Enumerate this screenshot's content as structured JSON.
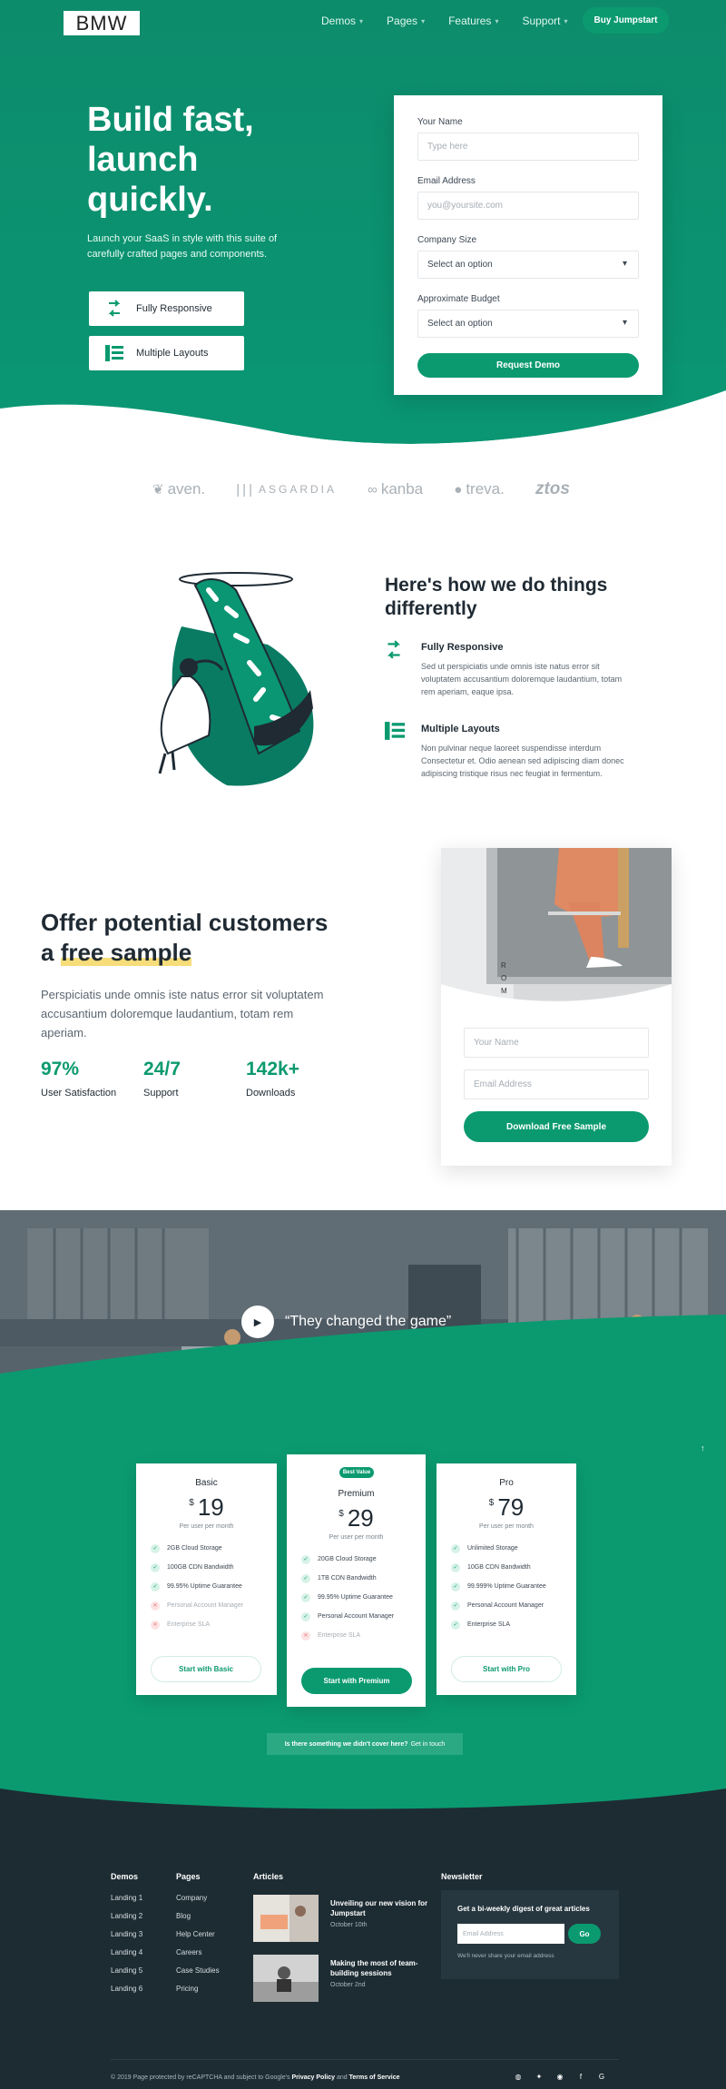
{
  "nav": {
    "logo": "BMW",
    "links": [
      "Demos",
      "Pages",
      "Features",
      "Support"
    ],
    "chevron": "▾",
    "cta": "Buy Jumpstart"
  },
  "hero": {
    "title": "Build fast, launch quickly.",
    "subtitle": "Launch your SaaS in style with this suite of carefully crafted pages and components.",
    "features": [
      {
        "label": "Fully Responsive",
        "icon": "responsive-arrows-icon"
      },
      {
        "label": "Multiple Layouts",
        "icon": "layouts-list-icon"
      }
    ],
    "form": {
      "name_label": "Your Name",
      "name_placeholder": "Type here",
      "email_label": "Email Address",
      "email_placeholder": "you@yoursite.com",
      "company_label": "Company Size",
      "company_value": "Select an option",
      "budget_label": "Approximate Budget",
      "budget_value": "Select an option",
      "submit": "Request Demo"
    }
  },
  "logos": [
    "aven.",
    "ASGARDIA",
    "kanba",
    "treva.",
    "ztos"
  ],
  "how": {
    "title": "Here's how we do things differently",
    "items": [
      {
        "title": "Fully Responsive",
        "text": "Sed ut perspiciatis unde omnis iste natus error sit voluptatem accusantium doloremque laudantium, totam rem aperiam, eaque ipsa.",
        "icon": "responsive-arrows-icon"
      },
      {
        "title": "Multiple Layouts",
        "text": "Non pulvinar neque laoreet suspendisse interdum Consectetur et. Odio aenean sed adipiscing diam donec adipiscing tristique risus nec feugiat in fermentum.",
        "icon": "layouts-list-icon"
      }
    ]
  },
  "offer": {
    "title_a": "Offer potential customers",
    "title_b": "a ",
    "title_hl": "free sample",
    "text": "Perspiciatis unde omnis iste natus error sit voluptatem accusantium doloremque laudantium, totam rem aperiam.",
    "stats": [
      {
        "value": "97%",
        "label": "User Satisfaction"
      },
      {
        "value": "24/7",
        "label": "Support"
      },
      {
        "value": "142k+",
        "label": "Downloads"
      }
    ],
    "photo_caption": [
      "R",
      "O",
      "M"
    ],
    "form": {
      "name_placeholder": "Your Name",
      "email_placeholder": "Email Address",
      "submit": "Download Free Sample"
    }
  },
  "video": {
    "quote": "“They changed the game”",
    "play_icon": "▶"
  },
  "pricing": {
    "plans": [
      {
        "name": "Basic",
        "currency": "$",
        "price": "19",
        "per": "Per user per month",
        "features": [
          {
            "text": "2GB Cloud Storage",
            "on": true
          },
          {
            "text": "100GB CDN Bandwidth",
            "on": true
          },
          {
            "text": "99.95% Uptime Guarantee",
            "on": true
          },
          {
            "text": "Personal Account Manager",
            "on": false
          },
          {
            "text": "Enterprise SLA",
            "on": false
          }
        ],
        "button": "Start with Basic"
      },
      {
        "name": "Premium",
        "badge": "Best Value",
        "currency": "$",
        "price": "29",
        "per": "Per user per month",
        "features": [
          {
            "text": "20GB Cloud Storage",
            "on": true
          },
          {
            "text": "1TB CDN Bandwidth",
            "on": true
          },
          {
            "text": "99.95% Uptime Guarantee",
            "on": true
          },
          {
            "text": "Personal Account Manager",
            "on": true
          },
          {
            "text": "Enterprise SLA",
            "on": false
          }
        ],
        "button": "Start with Premium"
      },
      {
        "name": "Pro",
        "currency": "$",
        "price": "79",
        "per": "Per user per month",
        "features": [
          {
            "text": "Unlimited Storage",
            "on": true
          },
          {
            "text": "10GB CDN Bandwidth",
            "on": true
          },
          {
            "text": "99.999% Uptime Guarantee",
            "on": true
          },
          {
            "text": "Personal Account Manager",
            "on": true
          },
          {
            "text": "Enterprise SLA",
            "on": true
          }
        ],
        "button": "Start with Pro"
      }
    ],
    "check_icon": "✓",
    "cross_icon": "✕",
    "cover_question": "Is there something we didn't cover here?",
    "cover_link": "Get in touch",
    "up_icon": "↑"
  },
  "footer": {
    "demos": {
      "heading": "Demos",
      "links": [
        "Landing 1",
        "Landing 2",
        "Landing 3",
        "Landing 4",
        "Landing 5",
        "Landing 6"
      ]
    },
    "pages": {
      "heading": "Pages",
      "links": [
        "Company",
        "Blog",
        "Help Center",
        "Careers",
        "Case Studies",
        "Pricing"
      ]
    },
    "articles": {
      "heading": "Articles",
      "items": [
        {
          "title": "Unveiling our new vision for Jumpstart",
          "date": "October 10th"
        },
        {
          "title": "Making the most of team-building sessions",
          "date": "October 2nd"
        }
      ]
    },
    "newsletter": {
      "heading": "Newsletter",
      "title": "Get a bi-weekly digest of great articles",
      "placeholder": "Email Address",
      "button": "Go",
      "note": "We'll never share your email address"
    },
    "copyright_a": "© 2019 Page protected by reCAPTCHA and subject to Google's",
    "privacy": "Privacy Policy",
    "and": "and",
    "terms": "Terms of Service",
    "socials": [
      "dribbble-icon",
      "twitter-icon",
      "github-icon",
      "facebook-icon",
      "google-icon"
    ],
    "social_glyphs": [
      "◍",
      "✦",
      "◉",
      "f",
      "G"
    ]
  },
  "colors": {
    "brand_green": "#0b9a6f",
    "dark_footer": "#1d2c33",
    "highlight": "#f6dd7a"
  }
}
